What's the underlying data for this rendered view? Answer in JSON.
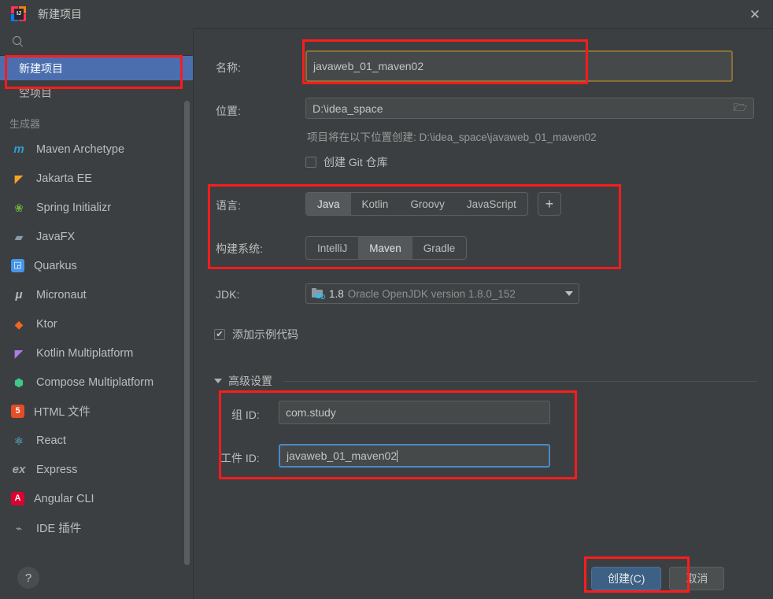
{
  "window": {
    "title": "新建项目",
    "app_icon": "intellij-idea-icon",
    "close_label": "✕"
  },
  "sidebar": {
    "search_placeholder": "",
    "tree": [
      {
        "label": "新建项目",
        "selected": true,
        "name": "sidebar-item-new-project"
      },
      {
        "label": "空项目",
        "selected": false,
        "name": "sidebar-item-empty-project"
      }
    ],
    "group_title": "生成器",
    "generators": [
      {
        "label": "Maven Archetype",
        "icon": "maven-icon",
        "glyph": "m",
        "color": "#2c9fd4"
      },
      {
        "label": "Jakarta EE",
        "icon": "jakarta-ee-icon",
        "glyph": "◤",
        "color": "#f5a623"
      },
      {
        "label": "Spring Initializr",
        "icon": "spring-icon",
        "glyph": "❀",
        "color": "#6db33f"
      },
      {
        "label": "JavaFX",
        "icon": "javafx-icon",
        "glyph": "▰",
        "color": "#8a9aa5"
      },
      {
        "label": "Quarkus",
        "icon": "quarkus-icon",
        "glyph": "◲",
        "color": "#4695eb"
      },
      {
        "label": "Micronaut",
        "icon": "micronaut-icon",
        "glyph": "μ",
        "color": "#b9b9b9"
      },
      {
        "label": "Ktor",
        "icon": "ktor-icon",
        "glyph": "◆",
        "color": "#f26522"
      },
      {
        "label": "Kotlin Multiplatform",
        "icon": "kotlin-multiplatform-icon",
        "glyph": "◤",
        "color": "#b07ae8"
      },
      {
        "label": "Compose Multiplatform",
        "icon": "compose-multiplatform-icon",
        "glyph": "⬢",
        "color": "#3ec98a"
      },
      {
        "label": "HTML 文件",
        "icon": "html5-icon",
        "glyph": "5",
        "color": "#e44d26"
      },
      {
        "label": "React",
        "icon": "react-icon",
        "glyph": "⚛",
        "color": "#61dafb"
      },
      {
        "label": "Express",
        "icon": "express-icon",
        "glyph": "ex",
        "color": "#a8a8a8"
      },
      {
        "label": "Angular CLI",
        "icon": "angular-icon",
        "glyph": "A",
        "color": "#dd0031"
      },
      {
        "label": "IDE 插件",
        "icon": "ide-plugin-icon",
        "glyph": "⌁",
        "color": "#9aa3a8"
      }
    ],
    "help_label": "?"
  },
  "form": {
    "name_label": "名称:",
    "name_value": "javaweb_01_maven02",
    "location_label": "位置:",
    "location_value": "D:\\idea_space",
    "location_browse_icon": "folder-open-icon",
    "path_hint": "项目将在以下位置创建: D:\\idea_space\\javaweb_01_maven02",
    "git_checkbox_label": "创建 Git 仓库",
    "git_checkbox_checked": false,
    "language_label": "语言:",
    "languages": [
      "Java",
      "Kotlin",
      "Groovy",
      "JavaScript"
    ],
    "language_selected": "Java",
    "language_add_label": "+",
    "build_system_label": "构建系统:",
    "build_systems": [
      "IntelliJ",
      "Maven",
      "Gradle"
    ],
    "build_system_selected": "Maven",
    "jdk_label": "JDK:",
    "jdk_version": "1.8",
    "jdk_description": "Oracle OpenJDK version 1.8.0_152",
    "sample_code_label": "添加示例代码",
    "sample_code_checked": true,
    "advanced_label": "高级设置",
    "advanced_expanded": true,
    "group_id_label": "组 ID:",
    "group_id_value": "com.study",
    "artifact_id_label": "工件 ID:",
    "artifact_id_value": "javaweb_01_maven02"
  },
  "footer": {
    "create_label": "创建(C)",
    "cancel_label": "取消"
  },
  "annotations": {
    "color": "#fb1c1c",
    "boxes": [
      "sidebar-new-project-highlight",
      "name-field-highlight",
      "language-build-highlight",
      "advanced-ids-highlight",
      "create-button-highlight"
    ]
  },
  "colors": {
    "background": "#3c3f41",
    "selection": "#4b6eaf",
    "primary_button": "#3d6185",
    "annotation_red": "#fb1c1c",
    "focus_blue": "#4a88c7",
    "focus_gold": "#8a7038"
  }
}
